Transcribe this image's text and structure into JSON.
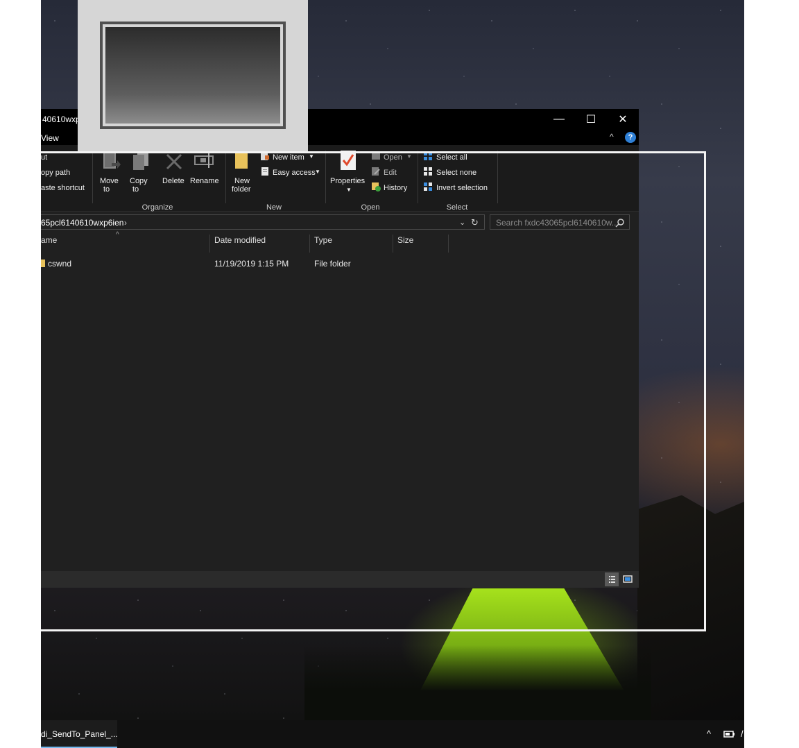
{
  "window": {
    "title": "40610wxp6ien",
    "menu_view": "View",
    "minimize": "—",
    "maximize": "☐",
    "close": "✕",
    "collapse": "^",
    "help": "?"
  },
  "ribbon": {
    "clipboard": {
      "cut": "ut",
      "copy_path": "opy path",
      "paste_shortcut": "aste shortcut"
    },
    "organize": {
      "label": "Organize",
      "move_to_line1": "Move",
      "move_to_line2": "to",
      "copy_to_line1": "Copy",
      "copy_to_line2": "to",
      "delete": "Delete",
      "rename": "Rename"
    },
    "new": {
      "label": "New",
      "new_item": "New item",
      "easy_access": "Easy access",
      "new_folder_line1": "New",
      "new_folder_line2": "folder"
    },
    "open": {
      "label": "Open",
      "properties": "Properties",
      "open": "Open",
      "edit": "Edit",
      "history": "History"
    },
    "select": {
      "label": "Select",
      "select_all": "Select all",
      "select_none": "Select none",
      "invert_selection": "Invert selection"
    }
  },
  "address": {
    "path": "65pcl6140610wxp6ien",
    "search_placeholder": "Search fxdc43065pcl6140610w..."
  },
  "columns": [
    "ame",
    "Date modified",
    "Type",
    "Size"
  ],
  "files": [
    {
      "name": "cswnd",
      "date": "11/19/2019 1:15 PM",
      "type": "File folder",
      "size": ""
    }
  ],
  "taskbar": {
    "item_label": "di_SendTo_Panel_...",
    "tray_chevron": "^",
    "tray_slash": "/"
  },
  "colors": {
    "accent_blue": "#2f80d6",
    "taskbar_underline": "#76b9ed",
    "folder_yellow": "#e8c25b"
  }
}
